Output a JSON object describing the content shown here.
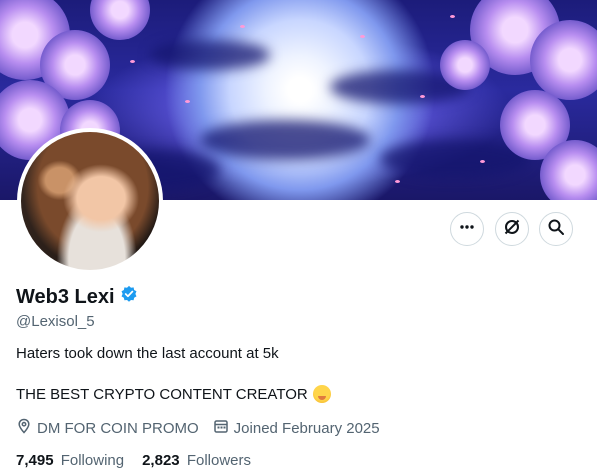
{
  "profile": {
    "display_name": "Web3 Lexi",
    "handle": "@Lexisol_5",
    "bio_line1": "Haters took down the last account at 5k",
    "bio_line2": "THE BEST CRYPTO CONTENT CREATOR",
    "location": "DM FOR COIN PROMO",
    "joined": "Joined February 2025",
    "following_count": "7,495",
    "following_label": "Following",
    "followers_count": "2,823",
    "followers_label": "Followers"
  },
  "actions": [
    {
      "icon": "more-icon"
    },
    {
      "icon": "grok-icon"
    },
    {
      "icon": "search-icon"
    }
  ],
  "icons": {
    "verified": "verified-badge-icon",
    "location": "location-pin-icon",
    "calendar": "calendar-icon",
    "emoji": "face-with-hand-over-mouth-emoji"
  },
  "colors": {
    "verified_blue": "#1d9bf0",
    "text_primary": "#0f1419",
    "text_secondary": "#536471",
    "border": "#cfd9de"
  }
}
